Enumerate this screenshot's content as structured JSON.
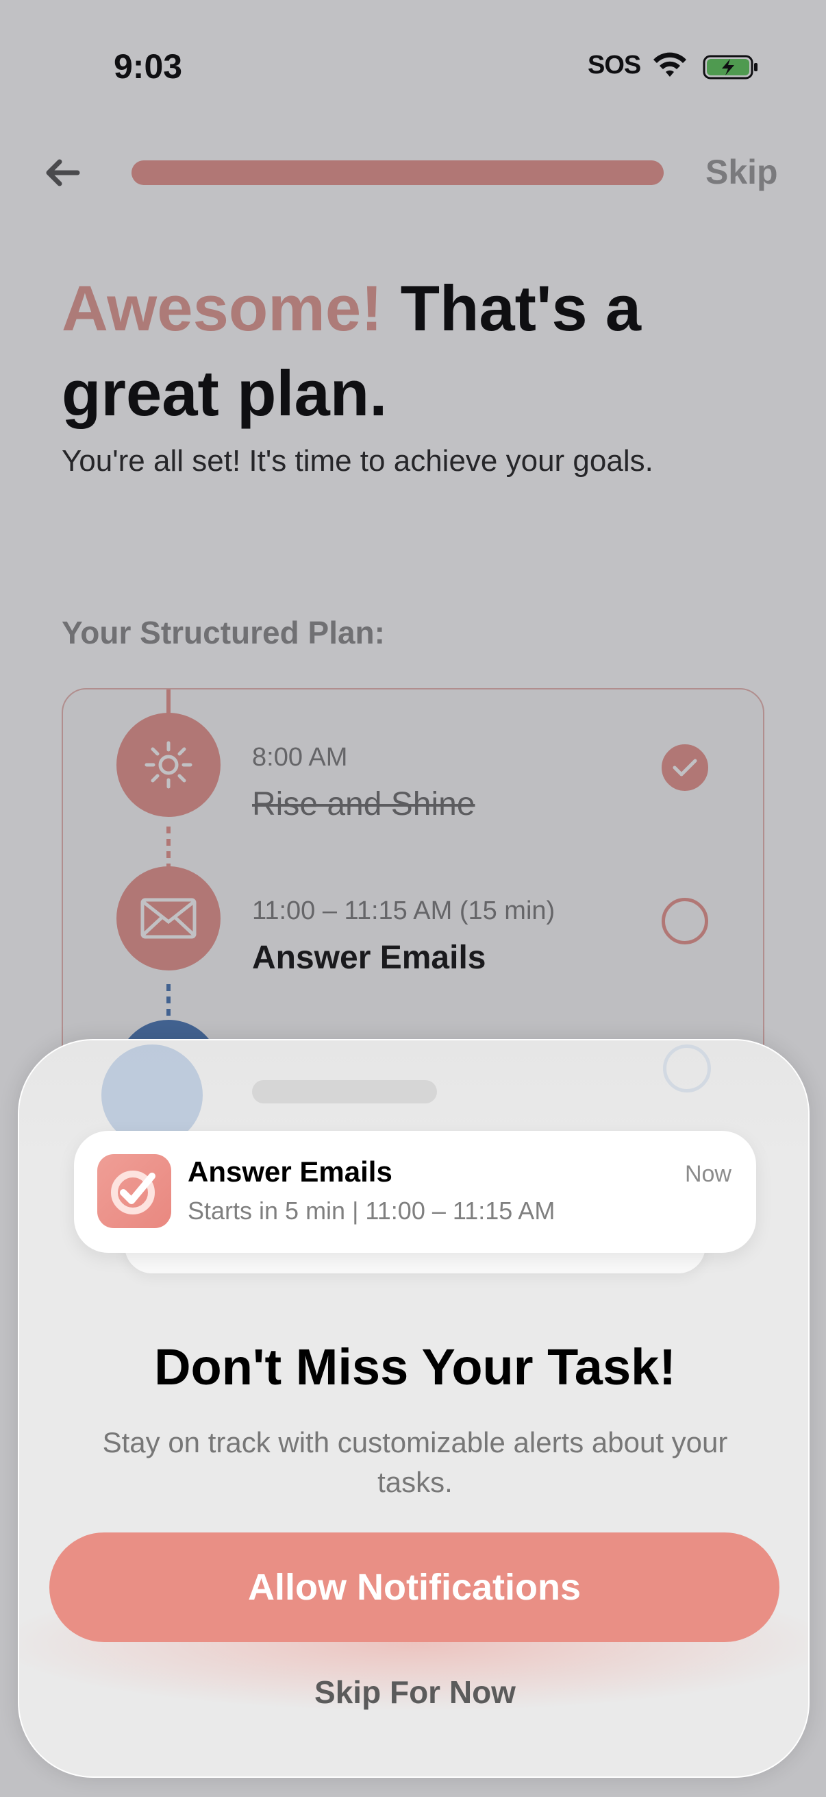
{
  "status_bar": {
    "time": "9:03",
    "carrier": "SOS",
    "wifi_icon": "wifi-icon",
    "battery_icon": "battery-charging-icon"
  },
  "nav": {
    "back_icon": "arrow-left-icon",
    "progress_fraction": 1.0,
    "skip_label": "Skip"
  },
  "header": {
    "headline_accent": "Awesome!",
    "headline_rest": " That's a great plan.",
    "subtitle": "You're all set! It's time to achieve your goals."
  },
  "plan": {
    "label": "Your Structured Plan:",
    "items": [
      {
        "time": "8:00 AM",
        "title": "Rise and Shine",
        "icon": "sun-icon",
        "done": true
      },
      {
        "time": "11:00 – 11:15 AM (15 min)",
        "title": "Answer Emails",
        "icon": "envelope-icon",
        "done": false
      }
    ]
  },
  "sheet": {
    "notification": {
      "app_icon": "app-check-icon",
      "title": "Answer Emails",
      "body": "Starts in 5 min | 11:00 – 11:15 AM",
      "time": "Now"
    },
    "title": "Don't Miss Your Task!",
    "description": "Stay on track with customizable alerts about your tasks.",
    "allow_label": "Allow Notifications",
    "skip_label": "Skip For Now"
  },
  "colors": {
    "accent": "#e8968e",
    "blue": "#4a78b5"
  }
}
